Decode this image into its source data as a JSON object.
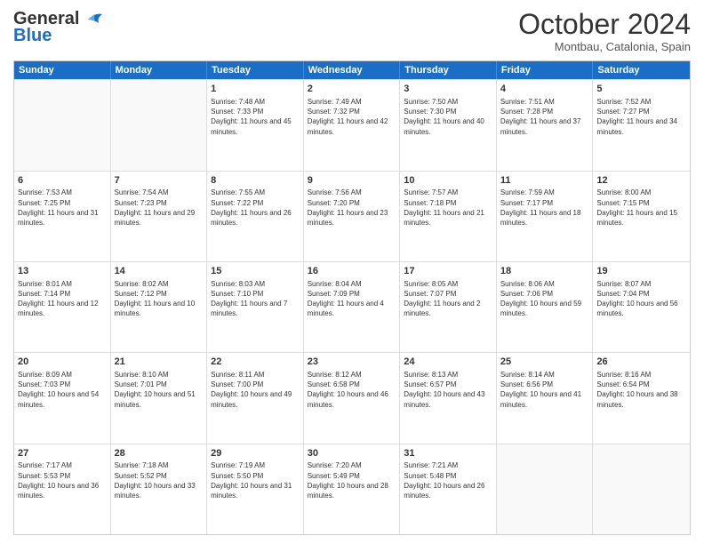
{
  "header": {
    "logo_line1": "General",
    "logo_line2": "Blue",
    "month": "October 2024",
    "location": "Montbau, Catalonia, Spain"
  },
  "days_of_week": [
    "Sunday",
    "Monday",
    "Tuesday",
    "Wednesday",
    "Thursday",
    "Friday",
    "Saturday"
  ],
  "weeks": [
    [
      {
        "day": "",
        "sunrise": "",
        "sunset": "",
        "daylight": "",
        "empty": true
      },
      {
        "day": "",
        "sunrise": "",
        "sunset": "",
        "daylight": "",
        "empty": true
      },
      {
        "day": "1",
        "sunrise": "Sunrise: 7:48 AM",
        "sunset": "Sunset: 7:33 PM",
        "daylight": "Daylight: 11 hours and 45 minutes."
      },
      {
        "day": "2",
        "sunrise": "Sunrise: 7:49 AM",
        "sunset": "Sunset: 7:32 PM",
        "daylight": "Daylight: 11 hours and 42 minutes."
      },
      {
        "day": "3",
        "sunrise": "Sunrise: 7:50 AM",
        "sunset": "Sunset: 7:30 PM",
        "daylight": "Daylight: 11 hours and 40 minutes."
      },
      {
        "day": "4",
        "sunrise": "Sunrise: 7:51 AM",
        "sunset": "Sunset: 7:28 PM",
        "daylight": "Daylight: 11 hours and 37 minutes."
      },
      {
        "day": "5",
        "sunrise": "Sunrise: 7:52 AM",
        "sunset": "Sunset: 7:27 PM",
        "daylight": "Daylight: 11 hours and 34 minutes."
      }
    ],
    [
      {
        "day": "6",
        "sunrise": "Sunrise: 7:53 AM",
        "sunset": "Sunset: 7:25 PM",
        "daylight": "Daylight: 11 hours and 31 minutes."
      },
      {
        "day": "7",
        "sunrise": "Sunrise: 7:54 AM",
        "sunset": "Sunset: 7:23 PM",
        "daylight": "Daylight: 11 hours and 29 minutes."
      },
      {
        "day": "8",
        "sunrise": "Sunrise: 7:55 AM",
        "sunset": "Sunset: 7:22 PM",
        "daylight": "Daylight: 11 hours and 26 minutes."
      },
      {
        "day": "9",
        "sunrise": "Sunrise: 7:56 AM",
        "sunset": "Sunset: 7:20 PM",
        "daylight": "Daylight: 11 hours and 23 minutes."
      },
      {
        "day": "10",
        "sunrise": "Sunrise: 7:57 AM",
        "sunset": "Sunset: 7:18 PM",
        "daylight": "Daylight: 11 hours and 21 minutes."
      },
      {
        "day": "11",
        "sunrise": "Sunrise: 7:59 AM",
        "sunset": "Sunset: 7:17 PM",
        "daylight": "Daylight: 11 hours and 18 minutes."
      },
      {
        "day": "12",
        "sunrise": "Sunrise: 8:00 AM",
        "sunset": "Sunset: 7:15 PM",
        "daylight": "Daylight: 11 hours and 15 minutes."
      }
    ],
    [
      {
        "day": "13",
        "sunrise": "Sunrise: 8:01 AM",
        "sunset": "Sunset: 7:14 PM",
        "daylight": "Daylight: 11 hours and 12 minutes."
      },
      {
        "day": "14",
        "sunrise": "Sunrise: 8:02 AM",
        "sunset": "Sunset: 7:12 PM",
        "daylight": "Daylight: 11 hours and 10 minutes."
      },
      {
        "day": "15",
        "sunrise": "Sunrise: 8:03 AM",
        "sunset": "Sunset: 7:10 PM",
        "daylight": "Daylight: 11 hours and 7 minutes."
      },
      {
        "day": "16",
        "sunrise": "Sunrise: 8:04 AM",
        "sunset": "Sunset: 7:09 PM",
        "daylight": "Daylight: 11 hours and 4 minutes."
      },
      {
        "day": "17",
        "sunrise": "Sunrise: 8:05 AM",
        "sunset": "Sunset: 7:07 PM",
        "daylight": "Daylight: 11 hours and 2 minutes."
      },
      {
        "day": "18",
        "sunrise": "Sunrise: 8:06 AM",
        "sunset": "Sunset: 7:06 PM",
        "daylight": "Daylight: 10 hours and 59 minutes."
      },
      {
        "day": "19",
        "sunrise": "Sunrise: 8:07 AM",
        "sunset": "Sunset: 7:04 PM",
        "daylight": "Daylight: 10 hours and 56 minutes."
      }
    ],
    [
      {
        "day": "20",
        "sunrise": "Sunrise: 8:09 AM",
        "sunset": "Sunset: 7:03 PM",
        "daylight": "Daylight: 10 hours and 54 minutes."
      },
      {
        "day": "21",
        "sunrise": "Sunrise: 8:10 AM",
        "sunset": "Sunset: 7:01 PM",
        "daylight": "Daylight: 10 hours and 51 minutes."
      },
      {
        "day": "22",
        "sunrise": "Sunrise: 8:11 AM",
        "sunset": "Sunset: 7:00 PM",
        "daylight": "Daylight: 10 hours and 49 minutes."
      },
      {
        "day": "23",
        "sunrise": "Sunrise: 8:12 AM",
        "sunset": "Sunset: 6:58 PM",
        "daylight": "Daylight: 10 hours and 46 minutes."
      },
      {
        "day": "24",
        "sunrise": "Sunrise: 8:13 AM",
        "sunset": "Sunset: 6:57 PM",
        "daylight": "Daylight: 10 hours and 43 minutes."
      },
      {
        "day": "25",
        "sunrise": "Sunrise: 8:14 AM",
        "sunset": "Sunset: 6:56 PM",
        "daylight": "Daylight: 10 hours and 41 minutes."
      },
      {
        "day": "26",
        "sunrise": "Sunrise: 8:16 AM",
        "sunset": "Sunset: 6:54 PM",
        "daylight": "Daylight: 10 hours and 38 minutes."
      }
    ],
    [
      {
        "day": "27",
        "sunrise": "Sunrise: 7:17 AM",
        "sunset": "Sunset: 5:53 PM",
        "daylight": "Daylight: 10 hours and 36 minutes."
      },
      {
        "day": "28",
        "sunrise": "Sunrise: 7:18 AM",
        "sunset": "Sunset: 5:52 PM",
        "daylight": "Daylight: 10 hours and 33 minutes."
      },
      {
        "day": "29",
        "sunrise": "Sunrise: 7:19 AM",
        "sunset": "Sunset: 5:50 PM",
        "daylight": "Daylight: 10 hours and 31 minutes."
      },
      {
        "day": "30",
        "sunrise": "Sunrise: 7:20 AM",
        "sunset": "Sunset: 5:49 PM",
        "daylight": "Daylight: 10 hours and 28 minutes."
      },
      {
        "day": "31",
        "sunrise": "Sunrise: 7:21 AM",
        "sunset": "Sunset: 5:48 PM",
        "daylight": "Daylight: 10 hours and 26 minutes."
      },
      {
        "day": "",
        "sunrise": "",
        "sunset": "",
        "daylight": "",
        "empty": true
      },
      {
        "day": "",
        "sunrise": "",
        "sunset": "",
        "daylight": "",
        "empty": true
      }
    ]
  ]
}
